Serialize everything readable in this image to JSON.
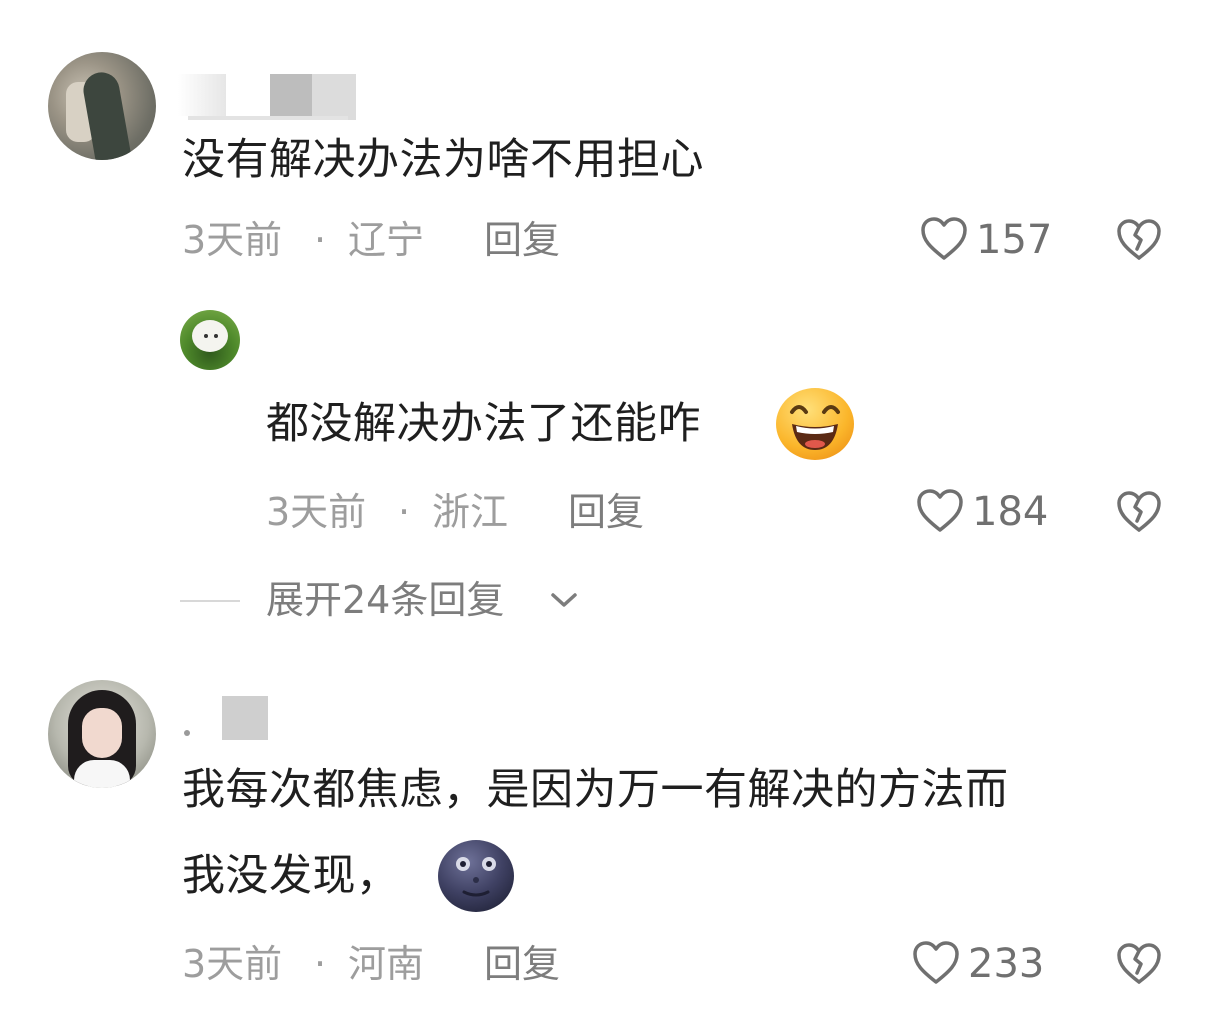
{
  "comments": [
    {
      "text": "没有解决办法为啥不用担心",
      "time": "3天前",
      "sep": "·",
      "location": "辽宁",
      "reply_label": "回复",
      "likes": "157"
    },
    {
      "text": "都没解决办法了还能咋",
      "time": "3天前",
      "sep": "·",
      "location": "浙江",
      "reply_label": "回复",
      "likes": "184",
      "expand_label": "展开24条回复"
    },
    {
      "text_line1": "我每次都焦虑，是因为万一有解决的方法而",
      "text_line2": "我没发现，",
      "time": "3天前",
      "sep": "·",
      "location": "河南",
      "reply_label": "回复",
      "likes": "233"
    }
  ],
  "icons": {
    "like": "heart-outline-icon",
    "dislike": "broken-heart-icon",
    "expand": "chevron-down-icon",
    "emoji_grin": "grinning-emoji",
    "emoji_moon": "new-moon-face-emoji"
  },
  "colors": {
    "text": "#1f1f1f",
    "meta": "#9d9d9d",
    "reply": "#7d7d7d",
    "count": "#707070",
    "icon": "#707070"
  }
}
